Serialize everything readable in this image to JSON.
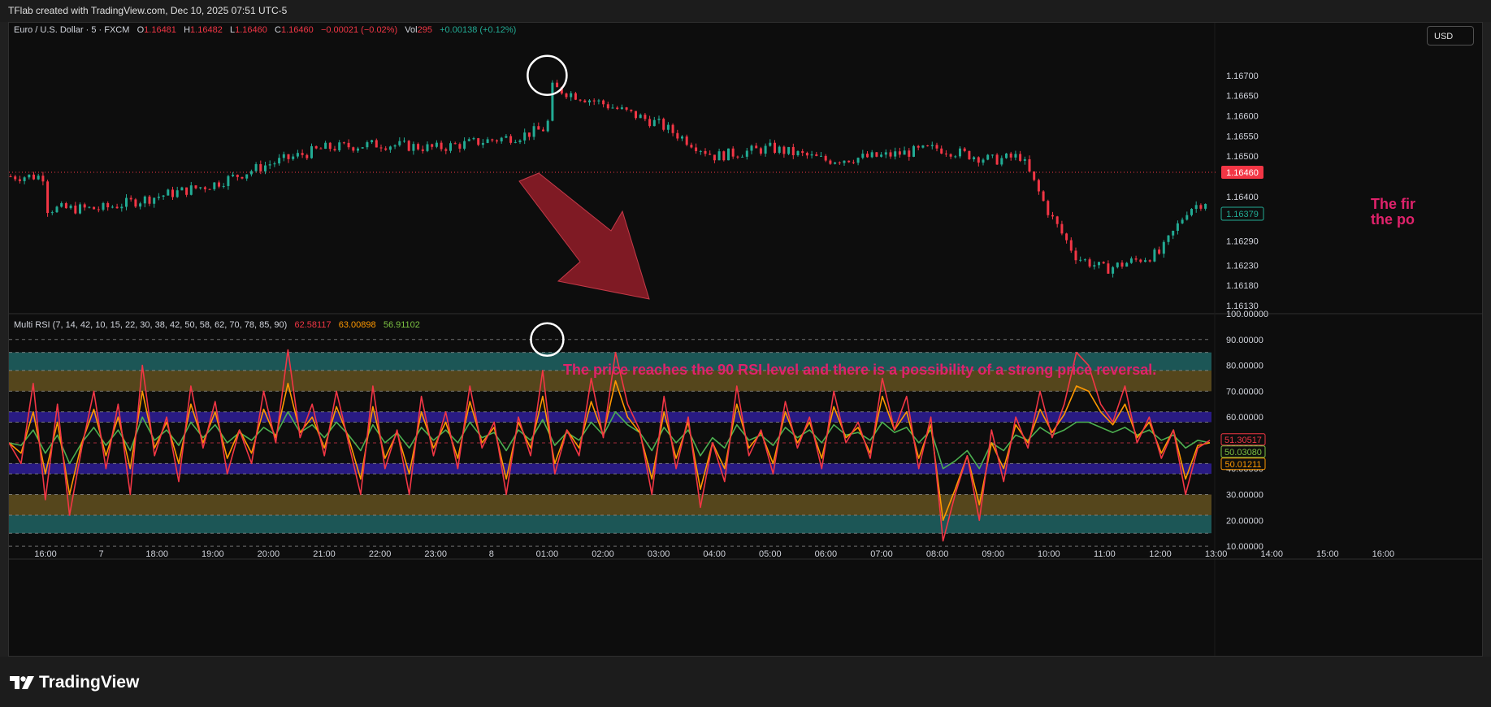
{
  "header": {
    "credit": "TFlab created with TradingView.com, Dec 10, 2025 07:51 UTC-5"
  },
  "price_pane": {
    "symbol": "Euro / U.S. Dollar · 5 · FXCM",
    "o_label": "O",
    "o_value": "1.16481",
    "h_label": "H",
    "h_value": "1.16482",
    "l_label": "L",
    "l_value": "1.16460",
    "c_label": "C",
    "c_value": "1.16460",
    "change": "−0.00021 (−0.02%)",
    "vol_label": "Vol",
    "vol_value": "295",
    "vol_change": "+0.00138 (+0.12%)",
    "currency_button": "USD",
    "last_price_tag": "1.16460",
    "secondary_price_tag": "1.16379",
    "annotation": "The first ... the pos...",
    "annotation_line1": "The first",
    "annotation_line2": "the pos"
  },
  "rsi_pane": {
    "title": "Multi RSI (7, 14, 42, 10, 15, 22, 30, 38, 42, 50, 58, 62, 70, 78, 85, 90)",
    "value1": "62.58117",
    "value2": "63.00898",
    "value3": "56.91102",
    "annotation": "The price reaches the 90 RSI level and there is a possibility of a strong price reversal.",
    "tag_red": "51.30517",
    "tag_green": "50.03080",
    "tag_orange": "50.01211"
  },
  "colors": {
    "up": "#22ab94",
    "down": "#f23645",
    "rsi_fast": "#f23645",
    "rsi_mid": "#ff9800",
    "rsi_slow": "#4caf50",
    "annotation": "#e0226b",
    "band_teal": "#1d5b5b",
    "band_gold": "#5a4a1e",
    "band_purple": "#2b1c8a"
  },
  "chart_data": [
    {
      "type": "candlestick",
      "title": "Euro / U.S. Dollar · 5 · FXCM",
      "y_ticks": [
        "1.16700",
        "1.16650",
        "1.16600",
        "1.16550",
        "1.16500",
        "1.16400",
        "1.16350",
        "1.16290",
        "1.16230",
        "1.16180",
        "1.16130"
      ],
      "ylim": [
        1.1611,
        1.1677
      ],
      "x_ticks": [
        "16:00",
        "7",
        "18:00",
        "19:00",
        "20:00",
        "21:00",
        "22:00",
        "23:00",
        "8",
        "01:00",
        "02:00",
        "03:00",
        "04:00",
        "05:00",
        "06:00",
        "07:00",
        "08:00",
        "09:00",
        "10:00",
        "11:00",
        "12:00",
        "13:00",
        "14:00",
        "15:00",
        "16:00"
      ],
      "last_price": 1.1646,
      "close_path": {
        "x": [
          "15:00",
          "16:00",
          "7",
          "18:00",
          "19:00",
          "20:00",
          "21:00",
          "22:00",
          "23:00",
          "8",
          "00:30",
          "01:00",
          "01:05",
          "02:00",
          "03:00",
          "04:00",
          "05:00",
          "06:00",
          "07:00",
          "08:00",
          "09:00",
          "09:30",
          "10:00",
          "10:30",
          "11:00",
          "11:30",
          "12:00",
          "12:30",
          "13:00",
          "14:00",
          "15:00",
          "16:00"
        ],
        "y": [
          1.1642,
          1.1645,
          1.1637,
          1.164,
          1.1643,
          1.1648,
          1.1652,
          1.1653,
          1.1652,
          1.1654,
          1.1655,
          1.1657,
          1.1667,
          1.1663,
          1.1658,
          1.165,
          1.1652,
          1.1649,
          1.165,
          1.1652,
          1.1649,
          1.165,
          1.1636,
          1.1625,
          1.1622,
          1.1624,
          1.1626,
          1.1637,
          1.164,
          1.164,
          1.1639,
          1.1637
        ]
      }
    },
    {
      "type": "line",
      "title": "Multi RSI (7, 14, 42, 10, 15, 22, 30, 38, 42, 50, 58, 62, 70, 78, 85, 90)",
      "y_ticks": [
        "100.00000",
        "90.00000",
        "80.00000",
        "70.00000",
        "60.00000",
        "50.00000",
        "40.00000",
        "30.00000",
        "20.00000",
        "10.00000"
      ],
      "ylim": [
        5,
        100
      ],
      "levels": [
        90,
        85,
        78,
        70,
        62,
        58,
        50,
        42,
        38,
        30,
        22,
        15,
        10
      ],
      "bands": [
        {
          "from": 78,
          "to": 85,
          "color": "teal"
        },
        {
          "from": 70,
          "to": 78,
          "color": "gold"
        },
        {
          "from": 58,
          "to": 62,
          "color": "purple"
        },
        {
          "from": 38,
          "to": 42,
          "color": "purple"
        },
        {
          "from": 22,
          "to": 30,
          "color": "gold"
        },
        {
          "from": 15,
          "to": 22,
          "color": "teal"
        }
      ],
      "series": [
        {
          "name": "RSI 7",
          "color": "red",
          "last": 51.30517,
          "values": [
            50,
            42,
            73,
            28,
            65,
            22,
            48,
            70,
            40,
            65,
            30,
            80,
            45,
            60,
            35,
            72,
            48,
            66,
            38,
            55,
            42,
            70,
            50,
            86,
            52,
            65,
            45,
            70,
            50,
            30,
            72,
            40,
            55,
            30,
            68,
            45,
            62,
            40,
            72,
            48,
            58,
            30,
            60,
            45,
            78,
            38,
            55,
            45,
            75,
            52,
            85,
            65,
            55,
            30,
            68,
            40,
            60,
            25,
            50,
            35,
            72,
            45,
            55,
            38,
            66,
            48,
            60,
            40,
            70,
            50,
            58,
            44,
            75,
            55,
            68,
            40,
            60,
            12,
            30,
            45,
            20,
            55,
            35,
            60,
            48,
            70,
            52,
            65,
            85,
            80,
            65,
            58,
            72,
            50,
            60,
            44,
            55,
            30,
            48,
            51
          ]
        },
        {
          "name": "RSI 14",
          "color": "orange",
          "last": 50.01211,
          "values": [
            50,
            46,
            62,
            38,
            58,
            30,
            50,
            63,
            45,
            60,
            40,
            70,
            48,
            58,
            42,
            65,
            50,
            62,
            44,
            55,
            46,
            63,
            52,
            73,
            54,
            60,
            48,
            64,
            52,
            36,
            64,
            44,
            54,
            38,
            62,
            48,
            58,
            44,
            66,
            50,
            56,
            36,
            58,
            48,
            68,
            42,
            55,
            48,
            66,
            53,
            74,
            60,
            54,
            36,
            62,
            44,
            58,
            32,
            50,
            40,
            65,
            48,
            54,
            42,
            62,
            50,
            58,
            44,
            64,
            52,
            56,
            46,
            68,
            55,
            62,
            44,
            57,
            20,
            32,
            45,
            26,
            50,
            40,
            57,
            50,
            63,
            54,
            61,
            72,
            70,
            62,
            57,
            65,
            52,
            58,
            46,
            55,
            36,
            49,
            50
          ]
        },
        {
          "name": "RSI 42",
          "color": "green",
          "last": 50.0308,
          "values": [
            50,
            49,
            55,
            46,
            53,
            42,
            50,
            56,
            49,
            55,
            47,
            60,
            51,
            55,
            49,
            58,
            52,
            57,
            50,
            54,
            51,
            56,
            53,
            62,
            54,
            57,
            52,
            58,
            53,
            47,
            57,
            50,
            54,
            48,
            56,
            51,
            55,
            50,
            58,
            52,
            54,
            47,
            55,
            51,
            59,
            49,
            54,
            51,
            58,
            53,
            62,
            57,
            54,
            47,
            56,
            50,
            55,
            45,
            52,
            48,
            57,
            51,
            53,
            49,
            56,
            52,
            55,
            50,
            57,
            53,
            54,
            51,
            58,
            54,
            56,
            50,
            55,
            40,
            43,
            47,
            40,
            50,
            47,
            53,
            51,
            56,
            53,
            55,
            58,
            58,
            56,
            54,
            56,
            53,
            55,
            51,
            53,
            48,
            51,
            50
          ]
        }
      ]
    }
  ]
}
